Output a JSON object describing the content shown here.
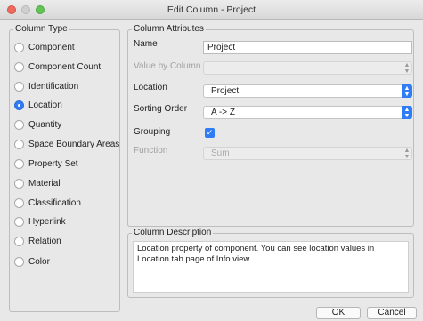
{
  "window": {
    "title": "Edit Column - Project"
  },
  "column_type": {
    "legend": "Column Type",
    "options": [
      {
        "label": "Component",
        "selected": false
      },
      {
        "label": "Component Count",
        "selected": false
      },
      {
        "label": "Identification",
        "selected": false
      },
      {
        "label": "Location",
        "selected": true
      },
      {
        "label": "Quantity",
        "selected": false
      },
      {
        "label": "Space Boundary Areas",
        "selected": false
      },
      {
        "label": "Property Set",
        "selected": false
      },
      {
        "label": "Material",
        "selected": false
      },
      {
        "label": "Classification",
        "selected": false
      },
      {
        "label": "Hyperlink",
        "selected": false
      },
      {
        "label": "Relation",
        "selected": false
      },
      {
        "label": "Color",
        "selected": false
      }
    ]
  },
  "column_attributes": {
    "legend": "Column Attributes",
    "name_label": "Name",
    "name_value": "Project",
    "value_by_column_label": "Value by Column",
    "value_by_column_value": "",
    "location_label": "Location",
    "location_value": "Project",
    "sorting_order_label": "Sorting Order",
    "sorting_order_value": "A -> Z",
    "grouping_label": "Grouping",
    "grouping_checked": true,
    "function_label": "Function",
    "function_value": "Sum"
  },
  "column_description": {
    "legend": "Column Description",
    "text": "Location property of component. You can see location values in Location tab page of Info view."
  },
  "buttons": {
    "ok": "OK",
    "cancel": "Cancel"
  },
  "colors": {
    "accent": "#2f7cf6",
    "close": "#ed6a5e",
    "maximize": "#61c554"
  }
}
